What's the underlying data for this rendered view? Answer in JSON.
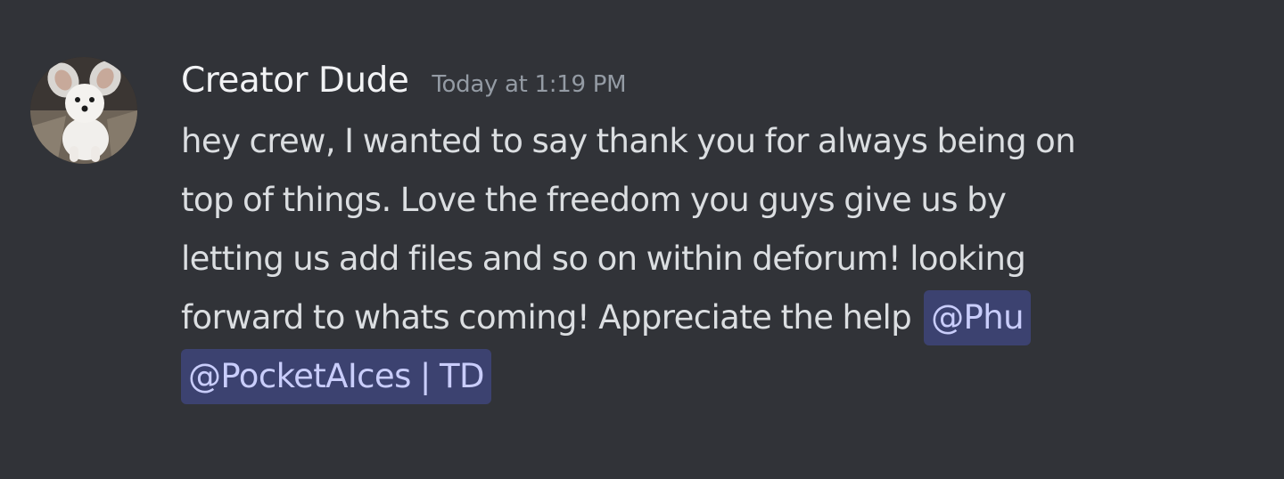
{
  "message": {
    "author": "Creator Dude",
    "timestamp": "Today at 1:19 PM",
    "lines": [
      "hey crew, I wanted to say thank you for always being on",
      "top of things. Love the freedom you guys give us by",
      "letting us add files and so on within deforum! looking",
      "forward to whats coming! Appreciate the help"
    ],
    "mentions": [
      "@Phu",
      "@PocketAIces | TD"
    ],
    "avatar": {
      "icon": "dog-avatar",
      "description": "white fluffy dog with large ears"
    }
  },
  "colors": {
    "background": "#313338",
    "username": "#f2f3f5",
    "timestamp": "#949ba4",
    "text": "#dbdee1",
    "mention_bg": "#3c4270",
    "mention_text": "#c9cdfb"
  }
}
